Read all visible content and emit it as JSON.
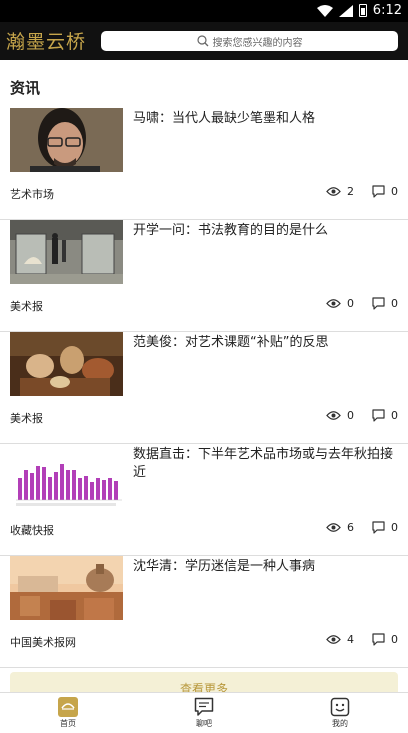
{
  "status_bar": {
    "time": "6:12"
  },
  "app": {
    "logo_text": "瀚墨云桥"
  },
  "search": {
    "placeholder": "搜索您感兴趣的内容"
  },
  "section": {
    "title": "资讯"
  },
  "articles": [
    {
      "title": "马啸：当代人最缺少笔墨和人格",
      "source": "艺术市场",
      "views": "2",
      "comments": "0",
      "thumb": "portrait"
    },
    {
      "title": "开学一问：书法教育的目的是什么",
      "source": "美术报",
      "views": "0",
      "comments": "0",
      "thumb": "gallery"
    },
    {
      "title": "范美俊：对艺术课题“补贴”的反思",
      "source": "美术报",
      "views": "0",
      "comments": "0",
      "thumb": "painting"
    },
    {
      "title": "数据直击：下半年艺术品市场或与去年秋拍接近",
      "source": "收藏快报",
      "views": "6",
      "comments": "0",
      "thumb": "barchart"
    },
    {
      "title": "沈华清：学历迷信是一种人事病",
      "source": "中国美术报网",
      "views": "4",
      "comments": "0",
      "thumb": "city"
    }
  ],
  "load_more": {
    "label": "查看更多"
  },
  "tabbar": {
    "tabs": [
      {
        "label": "首页",
        "icon": "home-icon",
        "active": true
      },
      {
        "label": "聊吧",
        "icon": "chat-icon",
        "active": false
      },
      {
        "label": "我的",
        "icon": "profile-icon",
        "active": false
      }
    ]
  },
  "colors": {
    "accent": "#c6a54b",
    "app_bar": "#111111",
    "chart_bar": "#b23fb8"
  }
}
